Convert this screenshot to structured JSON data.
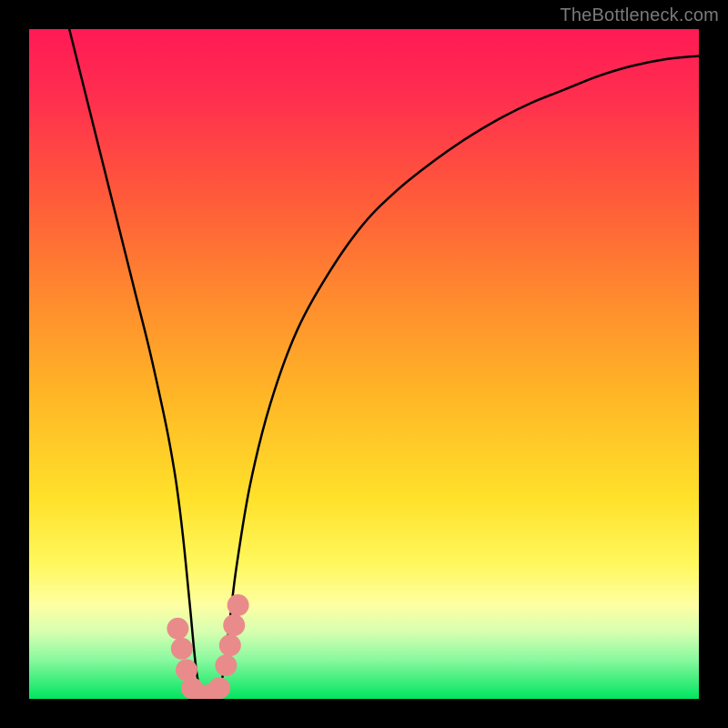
{
  "watermark": "TheBottleneck.com",
  "chart_data": {
    "type": "line",
    "title": "",
    "xlabel": "",
    "ylabel": "",
    "xlim": [
      0,
      100
    ],
    "ylim": [
      0,
      100
    ],
    "grid": false,
    "legend": false,
    "annotations": [],
    "background_gradient": {
      "stops": [
        {
          "offset": 0.0,
          "color": "#ff1a55"
        },
        {
          "offset": 0.1,
          "color": "#ff2e4f"
        },
        {
          "offset": 0.25,
          "color": "#ff5a3a"
        },
        {
          "offset": 0.4,
          "color": "#ff8a2e"
        },
        {
          "offset": 0.55,
          "color": "#ffb726"
        },
        {
          "offset": 0.7,
          "color": "#ffe12a"
        },
        {
          "offset": 0.8,
          "color": "#fff85e"
        },
        {
          "offset": 0.86,
          "color": "#feffa2"
        },
        {
          "offset": 0.9,
          "color": "#d6ffb0"
        },
        {
          "offset": 0.94,
          "color": "#8cf9a0"
        },
        {
          "offset": 1.0,
          "color": "#00e560"
        }
      ]
    },
    "series": [
      {
        "name": "bottleneck-curve",
        "color": "#000000",
        "x": [
          6,
          8,
          10,
          12,
          14,
          16,
          18,
          20,
          21,
          22,
          23,
          24,
          25,
          26,
          27,
          28,
          29,
          30,
          31,
          33,
          36,
          40,
          45,
          50,
          55,
          60,
          65,
          70,
          75,
          80,
          85,
          90,
          95,
          100
        ],
        "y": [
          100,
          92,
          84,
          76,
          68,
          60,
          52,
          43,
          38,
          32,
          24,
          14,
          4,
          0,
          0,
          0,
          4,
          12,
          20,
          32,
          44,
          55,
          64,
          71,
          76,
          80,
          83.5,
          86.5,
          89,
          91,
          93,
          94.5,
          95.5,
          96
        ]
      }
    ],
    "markers": {
      "name": "highlighted-points",
      "color": "#e98b8b",
      "points": [
        {
          "x": 22.2,
          "y": 10.5
        },
        {
          "x": 22.8,
          "y": 7.5
        },
        {
          "x": 23.5,
          "y": 4.3
        },
        {
          "x": 24.3,
          "y": 1.6
        },
        {
          "x": 25.5,
          "y": 0.6
        },
        {
          "x": 27.0,
          "y": 0.6
        },
        {
          "x": 28.4,
          "y": 1.6
        },
        {
          "x": 29.4,
          "y": 5.0
        },
        {
          "x": 30.0,
          "y": 8.0
        },
        {
          "x": 30.6,
          "y": 11.0
        },
        {
          "x": 31.2,
          "y": 14.0
        }
      ]
    }
  }
}
